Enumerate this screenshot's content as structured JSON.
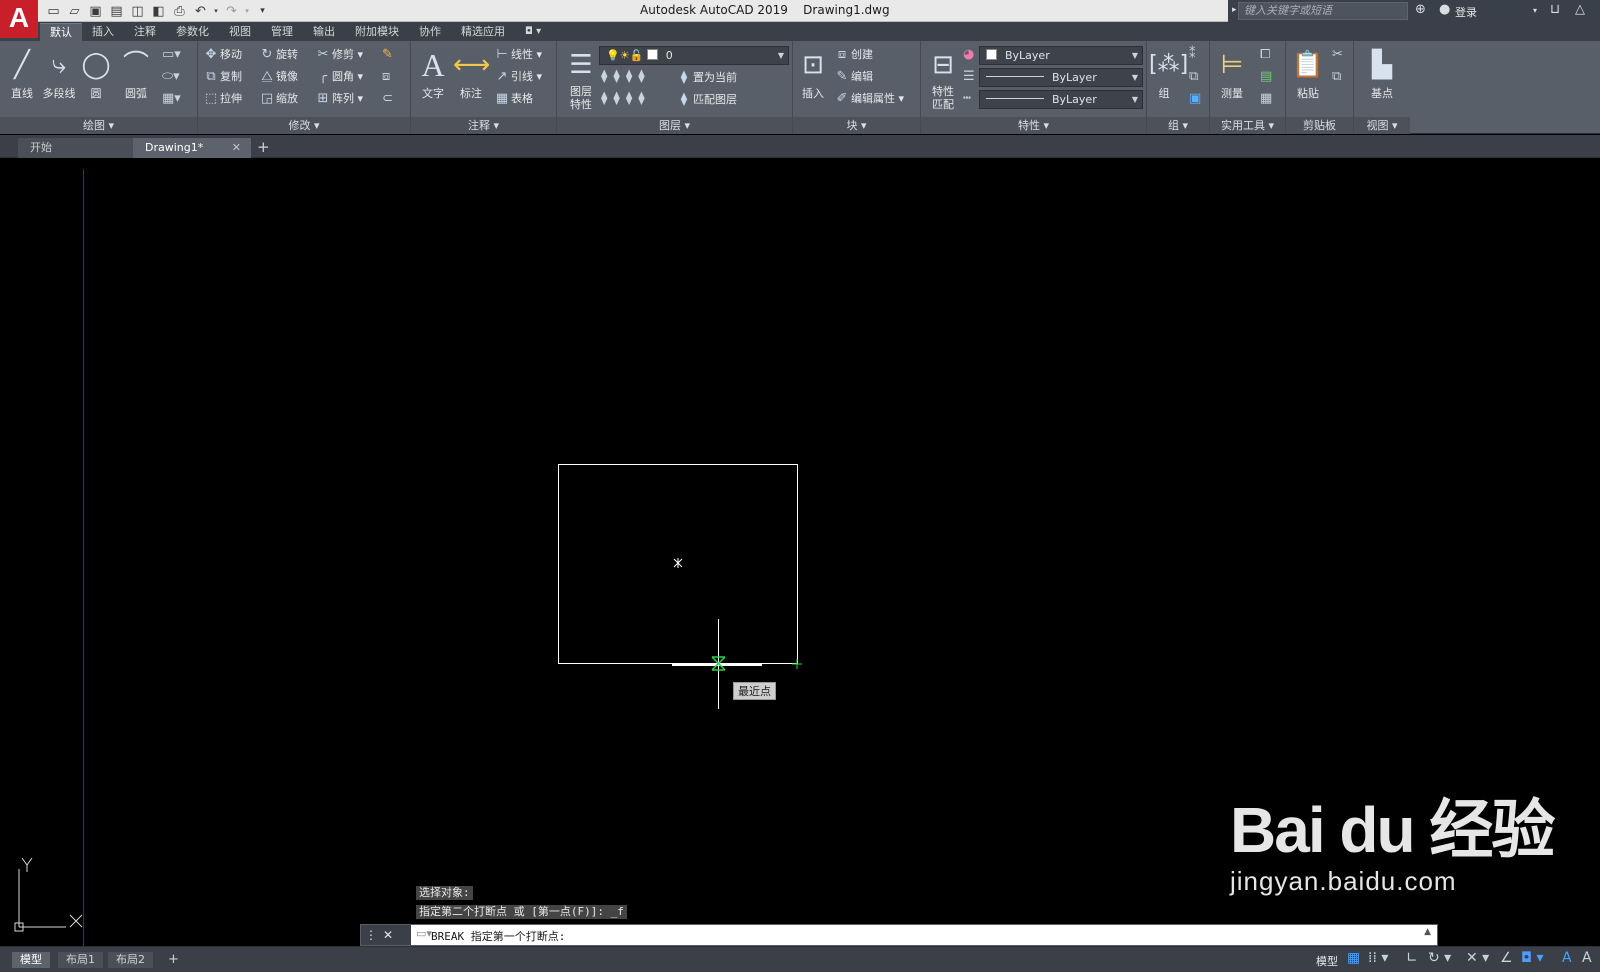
{
  "app": {
    "logo_letter": "A",
    "title": "Autodesk AutoCAD 2019    Drawing1.dwg",
    "search_placeholder": "键入关键字或短语",
    "login_label": "登录"
  },
  "ribbon_tabs": [
    "默认",
    "插入",
    "注释",
    "参数化",
    "视图",
    "管理",
    "输出",
    "附加模块",
    "协作",
    "精选应用"
  ],
  "ribbon": {
    "draw": {
      "title": "绘图 ▾",
      "line": "直线",
      "polyline": "多段线",
      "circle": "圆",
      "arc": "圆弧"
    },
    "modify": {
      "title": "修改 ▾",
      "move": "移动",
      "rotate": "旋转",
      "trim": "修剪",
      "copy": "复制",
      "mirror": "镜像",
      "fillet": "圆角",
      "stretch": "拉伸",
      "scale": "缩放",
      "array": "阵列"
    },
    "annotation": {
      "title": "注释 ▾",
      "text": "文字",
      "dimension": "标注",
      "linear": "线性",
      "leader": "引线",
      "table": "表格"
    },
    "layers": {
      "title": "图层 ▾",
      "layer_properties": "图层特性",
      "current_layer": "0",
      "make_current": "置为当前",
      "match_layer": "匹配图层"
    },
    "block": {
      "title": "块 ▾",
      "insert": "插入",
      "create": "创建",
      "edit": "编辑",
      "edit_attributes": "编辑属性"
    },
    "properties": {
      "title": "特性 ▾",
      "match_properties": "特性匹配",
      "color": "ByLayer",
      "linetype": "ByLayer",
      "lineweight": "ByLayer"
    },
    "group": {
      "title": "组 ▾",
      "group": "组"
    },
    "utilities": {
      "title": "实用工具 ▾",
      "measure": "测量"
    },
    "clipboard": {
      "title": "剪贴板",
      "paste": "粘贴"
    },
    "view": {
      "title": "视图 ▾",
      "base": "基点"
    }
  },
  "doc_tabs": {
    "start": "开始",
    "drawing": "Drawing1*"
  },
  "canvas": {
    "tooltip": "最近点",
    "ucs_y": "Y",
    "ucs_x": "X"
  },
  "command": {
    "history": [
      "选择对象:",
      "指定第二个打断点 或 [第一点(F)]: _f"
    ],
    "prompt": "BREAK 指定第一个打断点:"
  },
  "layout_tabs": [
    "模型",
    "布局1",
    "布局2"
  ],
  "status": {
    "model": "模型"
  },
  "watermark": {
    "logo": "Bai du 经验",
    "url": "jingyan.baidu.com"
  }
}
